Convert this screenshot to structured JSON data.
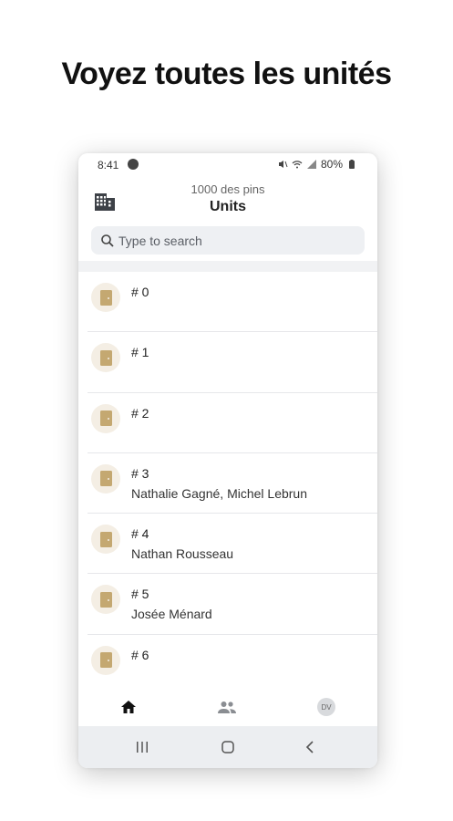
{
  "promo": {
    "headline": "Voyez toutes les unités"
  },
  "status_bar": {
    "time": "8:41",
    "battery": "80%"
  },
  "header": {
    "subtitle": "1000 des pins",
    "title": "Units"
  },
  "search": {
    "placeholder": "Type to search",
    "value": ""
  },
  "units": [
    {
      "number": "# 0",
      "residents": ""
    },
    {
      "number": "# 1",
      "residents": ""
    },
    {
      "number": "# 2",
      "residents": ""
    },
    {
      "number": "# 3",
      "residents": "Nathalie Gagné, Michel Lebrun"
    },
    {
      "number": "# 4",
      "residents": "Nathan Rousseau"
    },
    {
      "number": "# 5",
      "residents": "Josée Ménard"
    },
    {
      "number": "# 6",
      "residents": ""
    }
  ],
  "bottom_nav": {
    "profile_initials": "DV"
  },
  "colors": {
    "door_accent": "#c4a871",
    "door_bg": "#f4eee4",
    "search_bg": "#eef0f3"
  },
  "icons": [
    "building-icon",
    "search-icon",
    "door-icon",
    "home-icon",
    "people-icon",
    "recents-icon",
    "home-circle-icon",
    "back-icon"
  ]
}
